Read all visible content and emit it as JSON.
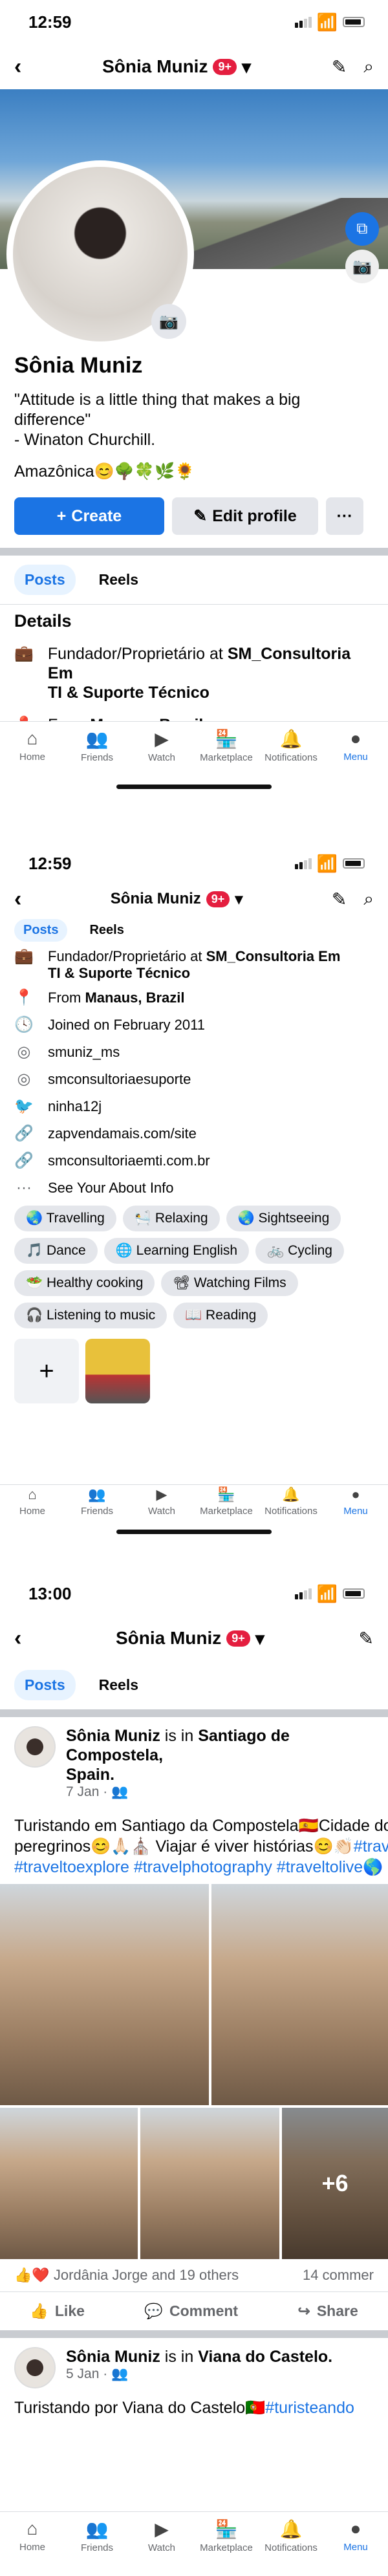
{
  "status": {
    "time1": "12:59",
    "time2": "12:59",
    "time3": "13:00"
  },
  "nav": {
    "name": "Sônia Muniz",
    "badge": "9+"
  },
  "profile": {
    "name": "Sônia Muniz",
    "bio1": "\"Attitude is a little thing that makes a big",
    "bio2": "difference\"",
    "bio3": "- Winaton Churchill.",
    "bio4": "Amazônica😊🌳🍀🌿🌻"
  },
  "buttons": {
    "create": "Create",
    "edit": "Edit profile",
    "more": "···"
  },
  "tabs": {
    "posts": "Posts",
    "reels": "Reels"
  },
  "details": {
    "title": "Details",
    "work1": "Fundador/Proprietário at ",
    "work_bold1": "SM_Consultoria Em",
    "work_bold2": "TI & Suporte Técnico",
    "from_prefix": "From ",
    "from": "Manaus, Brazil",
    "joined": "Joined on February 2011",
    "instagram1": "smuniz_ms",
    "instagram2": "smconsultoriaesuporte",
    "twitter": "ninha12j",
    "link1": "zapvendamais.com/site",
    "link2": "smconsultoriaemti.com.br",
    "about": "See Your About Info"
  },
  "hobbies": [
    "🌏 Travelling",
    "🛀 Relaxing",
    "🌏 Sightseeing",
    "🎵 Dance",
    "🌐 Learning English",
    "🚲 Cycling",
    "🥗 Healthy cooking",
    "📽 Watching Films",
    "🎧 Listening to music",
    "📖 Reading"
  ],
  "bottomnav": [
    {
      "label": "Home",
      "icon": "⌂"
    },
    {
      "label": "Friends",
      "icon": "👥"
    },
    {
      "label": "Watch",
      "icon": "▶"
    },
    {
      "label": "Marketplace",
      "icon": "🏪"
    },
    {
      "label": "Notifications",
      "icon": "🔔"
    },
    {
      "label": "Menu",
      "icon": "●"
    }
  ],
  "post1": {
    "author": "Sônia Muniz",
    "is_in": " is in ",
    "place1": "Santiago de Compostela,",
    "place2": "Spain.",
    "date": "7 Jan · 👥",
    "text1": "Turistando em Santiago da Compostela🇪🇸Cidade dos",
    "text2": "peregrinos😊🙏🏻⛪ Viajar é viver histórias😊👏🏻",
    "tag1": "#trave",
    "tags": "#traveltoexplore #travelphotography #traveltolive🌎",
    "plus": "+6",
    "reactions": "Jordânia Jorge and 19 others",
    "comments": "14 commer",
    "like": "Like",
    "comment": "Comment",
    "share": "Share"
  },
  "post2": {
    "author": "Sônia Muniz",
    "is_in": " is in ",
    "place": "Viana do Castelo.",
    "date": "5 Jan · 👥",
    "text": "Turistando por Viana do Castelo🇵🇹",
    "tag": "#turisteando"
  }
}
